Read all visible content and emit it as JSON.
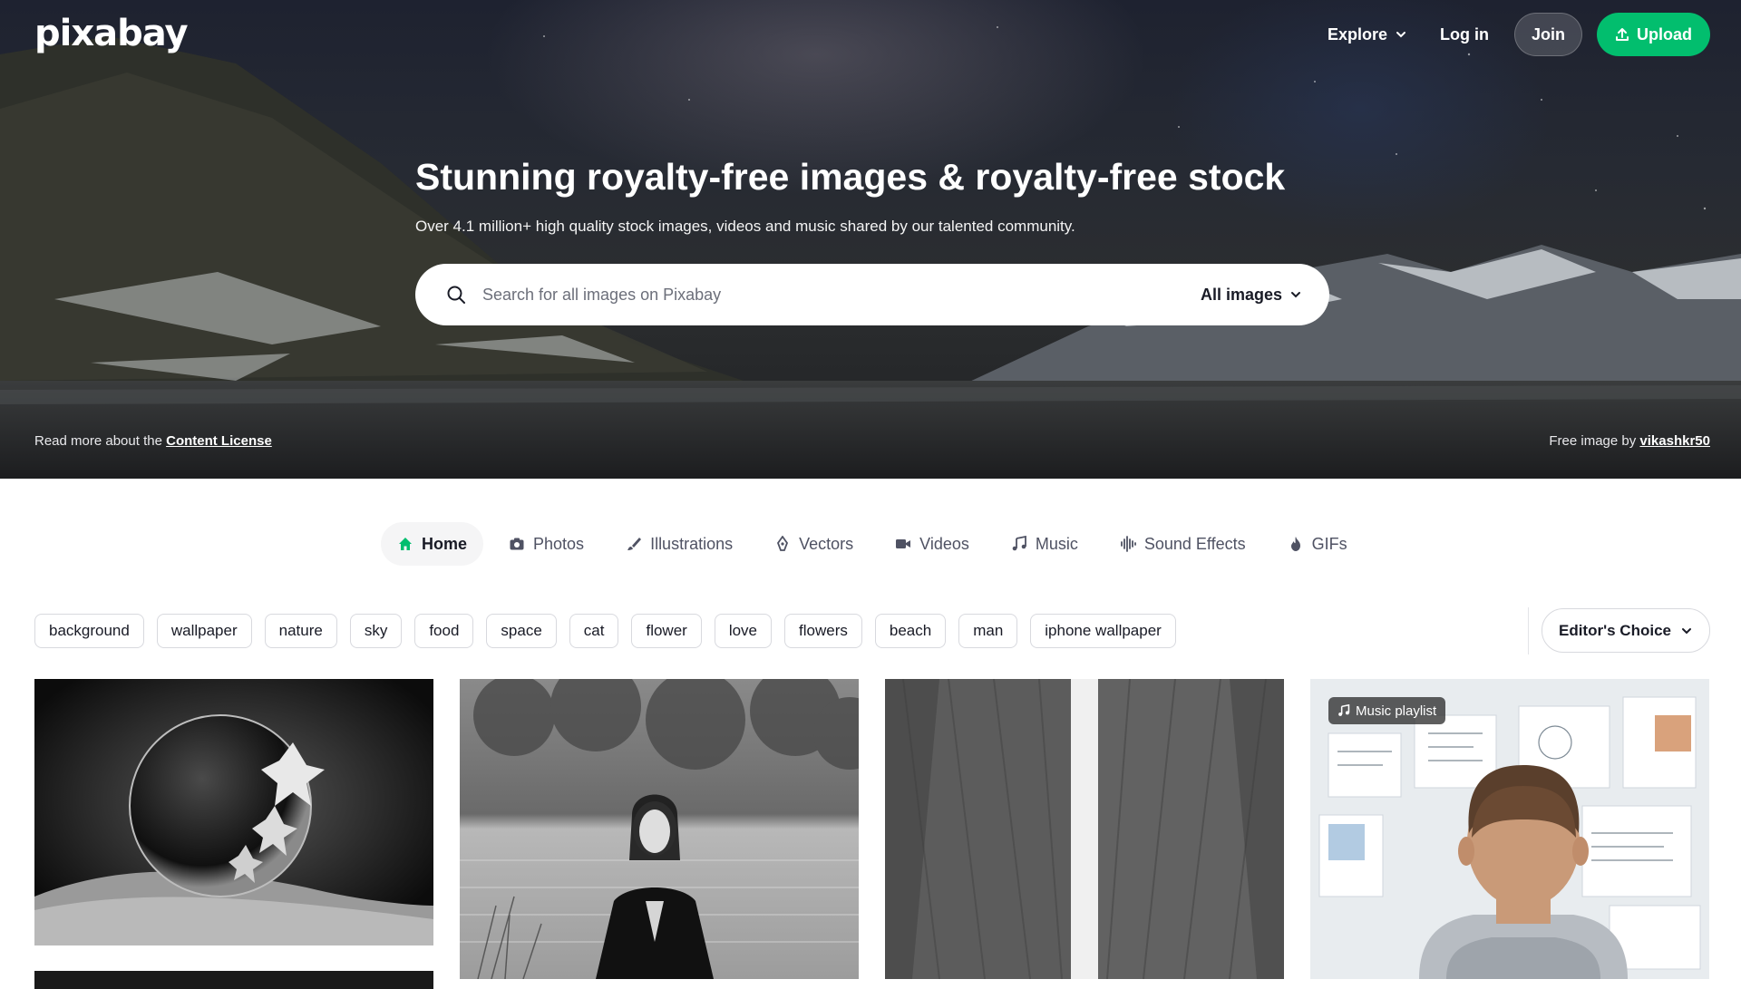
{
  "brand": {
    "logo_text": "pixabay"
  },
  "nav": {
    "explore_label": "Explore",
    "login_label": "Log in",
    "join_label": "Join",
    "upload_label": "Upload"
  },
  "hero": {
    "title": "Stunning royalty-free images & royalty-free stock",
    "subtitle": "Over 4.1 million+ high quality stock images, videos and music shared by our talented community.",
    "search": {
      "placeholder": "Search for all images on Pixabay",
      "value": "",
      "type_label": "All images"
    },
    "license_prefix": "Read more about the",
    "license_link": "Content License",
    "credit_prefix": "Free image by",
    "credit_user": "vikashkr50"
  },
  "tabs": [
    {
      "label": "Home",
      "icon": "home-icon",
      "active": true
    },
    {
      "label": "Photos",
      "icon": "camera-icon"
    },
    {
      "label": "Illustrations",
      "icon": "brush-icon"
    },
    {
      "label": "Vectors",
      "icon": "pen-nib-icon"
    },
    {
      "label": "Videos",
      "icon": "video-camera-icon"
    },
    {
      "label": "Music",
      "icon": "music-note-icon"
    },
    {
      "label": "Sound Effects",
      "icon": "waveform-icon"
    },
    {
      "label": "GIFs",
      "icon": "flame-icon"
    }
  ],
  "tags": [
    "background",
    "wallpaper",
    "nature",
    "sky",
    "food",
    "space",
    "cat",
    "flower",
    "love",
    "flowers",
    "beach",
    "man",
    "iphone wallpaper"
  ],
  "sort": {
    "label": "Editor's Choice"
  },
  "gallery": {
    "badge_label": "Music playlist"
  },
  "colors": {
    "accent": "#02be6e",
    "text": "#191b26",
    "muted": "#4f5263"
  }
}
